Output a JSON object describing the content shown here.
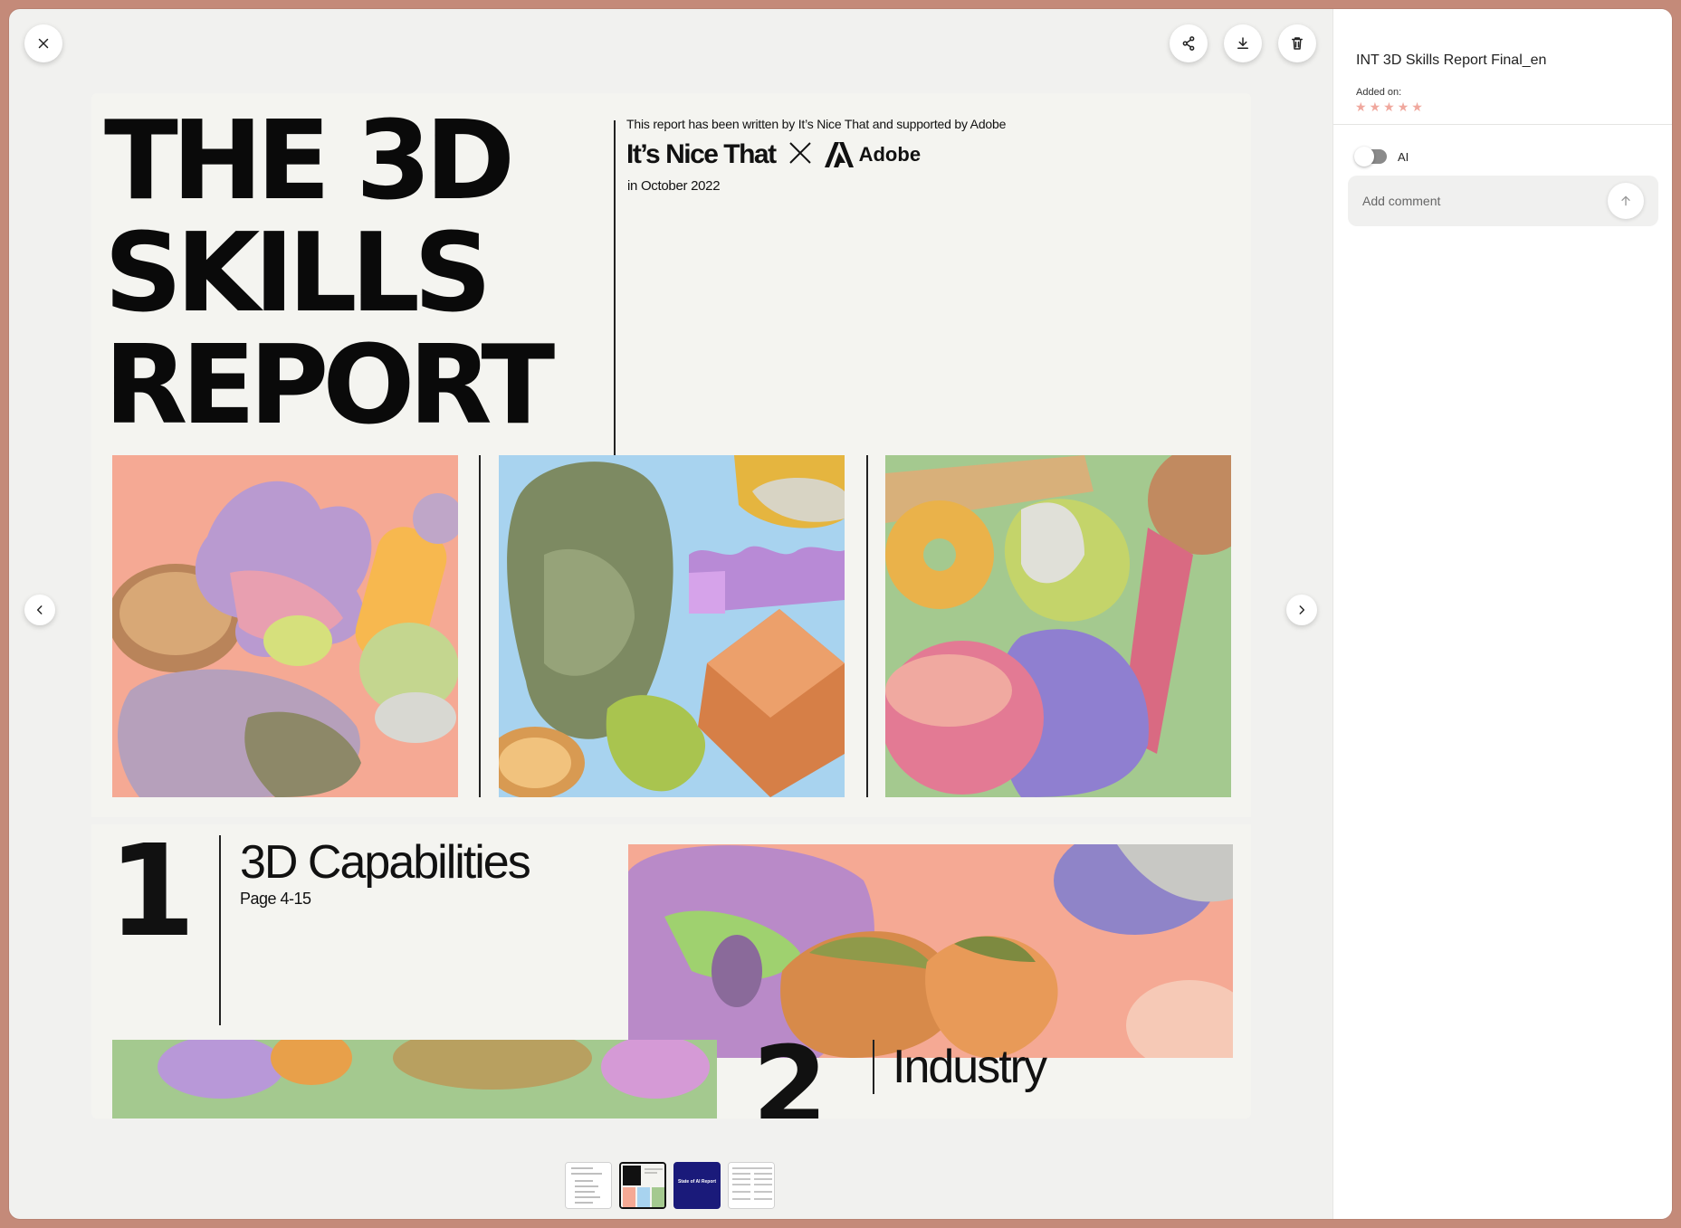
{
  "app": {
    "accent_color": "#c48a79",
    "background_color": "#f1f1ef"
  },
  "toolbar": {
    "close_icon": "close-icon",
    "share_icon": "share-icon",
    "download_icon": "download-icon",
    "delete_icon": "trash-icon"
  },
  "navigation": {
    "prev_icon": "chevron-left-icon",
    "next_icon": "chevron-right-icon"
  },
  "document": {
    "cover": {
      "title_lines": [
        "THE 3D",
        "SKILLS",
        "REPORT"
      ],
      "credit": "This report has been written by It’s Nice That and supported by Adobe",
      "brand_left": "It’s Nice That",
      "brand_right": "Adobe",
      "date": "in October 2022",
      "tile_colors": [
        "#f5a994",
        "#a8d3ef",
        "#a4c98f"
      ]
    },
    "section1": {
      "number": "1",
      "title": "3D Capabilities",
      "pages": "Page 4-15"
    },
    "section2": {
      "number": "2",
      "title": "Industry"
    }
  },
  "thumbnails": [
    {
      "label": "",
      "active": false
    },
    {
      "label": "",
      "active": true
    },
    {
      "label": "State of AI Report",
      "active": false
    },
    {
      "label": "",
      "active": false
    }
  ],
  "sidebar": {
    "title": "INT 3D Skills Report Final_en",
    "added_label": "Added on:",
    "stars": [
      "★",
      "★",
      "★",
      "★",
      "★"
    ],
    "star_color": "#f0a89e",
    "ai_label": "AI",
    "ai_enabled": false,
    "comment_placeholder": "Add comment",
    "send_icon": "arrow-up-icon"
  }
}
